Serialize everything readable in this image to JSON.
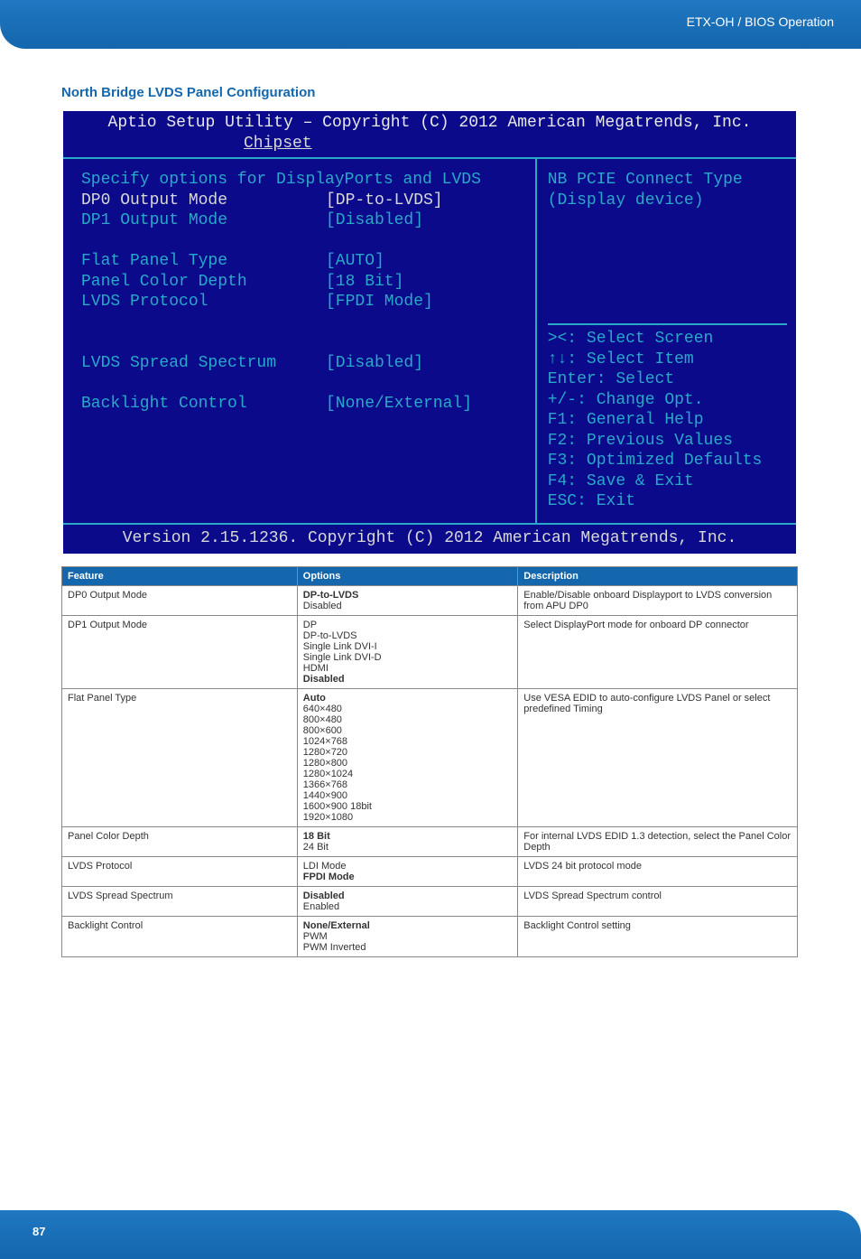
{
  "header": {
    "text": "ETX-OH / BIOS Operation"
  },
  "section_title": "North Bridge LVDS Panel Configuration",
  "bios": {
    "title": "Aptio Setup Utility – Copyright (C) 2012 American Megatrends, Inc.",
    "tab": "Chipset",
    "heading": "Specify options for DisplayPorts and LVDS",
    "items": {
      "dp0_label": "DP0 Output Mode",
      "dp0_value": "[DP-to-LVDS]",
      "dp1_label": "DP1 Output Mode",
      "dp1_value": "[Disabled]",
      "fpt_label": "Flat Panel Type",
      "fpt_value": "[AUTO]",
      "pcd_label": "Panel Color Depth",
      "pcd_value": "[18 Bit]",
      "proto_label": "LVDS Protocol",
      "proto_value": "[FPDI Mode]",
      "ss_label": "LVDS Spread Spectrum",
      "ss_value": "[Disabled]",
      "bl_label": "Backlight Control",
      "bl_value": "[None/External]"
    },
    "help": {
      "line1": "NB PCIE Connect Type",
      "line2": "(Display device)",
      "nav1": "><: Select Screen",
      "nav2": "↑↓: Select Item",
      "nav3": "Enter: Select",
      "nav4": "+/-: Change Opt.",
      "nav5": "F1: General Help",
      "nav6": "F2: Previous Values",
      "nav7": "F3: Optimized Defaults",
      "nav8": "F4: Save & Exit",
      "nav9": "ESC: Exit"
    },
    "footer": "Version 2.15.1236. Copyright (C) 2012 American Megatrends, Inc."
  },
  "table": {
    "headers": {
      "feature": "Feature",
      "options": "Options",
      "description": "Description"
    },
    "rows": [
      {
        "feature": "DP0 Output Mode",
        "options": [
          {
            "text": "DP-to-LVDS",
            "bold": true
          },
          {
            "text": "Disabled",
            "bold": false
          }
        ],
        "description": "Enable/Disable onboard Displayport to LVDS conversion from APU DP0"
      },
      {
        "feature": "DP1 Output Mode",
        "options": [
          {
            "text": "DP",
            "bold": false
          },
          {
            "text": "DP-to-LVDS",
            "bold": false
          },
          {
            "text": "Single Link DVI-I",
            "bold": false
          },
          {
            "text": "Single Link DVI-D",
            "bold": false
          },
          {
            "text": "HDMI",
            "bold": false
          },
          {
            "text": "Disabled",
            "bold": true
          }
        ],
        "description": "Select DisplayPort mode for onboard DP connector"
      },
      {
        "feature": "Flat Panel Type",
        "options": [
          {
            "text": "Auto",
            "bold": true
          },
          {
            "text": "640×480",
            "bold": false
          },
          {
            "text": "800×480",
            "bold": false
          },
          {
            "text": "800×600",
            "bold": false
          },
          {
            "text": "1024×768",
            "bold": false
          },
          {
            "text": "1280×720",
            "bold": false
          },
          {
            "text": "1280×800",
            "bold": false
          },
          {
            "text": "1280×1024",
            "bold": false
          },
          {
            "text": "1366×768",
            "bold": false
          },
          {
            "text": "1440×900",
            "bold": false
          },
          {
            "text": "1600×900 18bit",
            "bold": false
          },
          {
            "text": "1920×1080",
            "bold": false
          }
        ],
        "description": "Use VESA EDID to auto-configure LVDS Panel or select predefined Timing"
      },
      {
        "feature": "Panel Color Depth",
        "options": [
          {
            "text": "18 Bit",
            "bold": true
          },
          {
            "text": "24 Bit",
            "bold": false
          }
        ],
        "description": "For internal LVDS EDID 1.3 detection, select the Panel Color Depth"
      },
      {
        "feature": "LVDS Protocol",
        "options": [
          {
            "text": "LDI Mode",
            "bold": false
          },
          {
            "text": "FPDI Mode",
            "bold": true
          }
        ],
        "description": "LVDS 24 bit protocol mode"
      },
      {
        "feature": "LVDS Spread Spectrum",
        "options": [
          {
            "text": "Disabled",
            "bold": true
          },
          {
            "text": "Enabled",
            "bold": false
          }
        ],
        "description": "LVDS Spread Spectrum control"
      },
      {
        "feature": "Backlight Control",
        "options": [
          {
            "text": "None/External",
            "bold": true
          },
          {
            "text": "PWM",
            "bold": false
          },
          {
            "text": "PWM Inverted",
            "bold": false
          }
        ],
        "description": "Backlight Control setting"
      }
    ]
  },
  "page_number": "87"
}
